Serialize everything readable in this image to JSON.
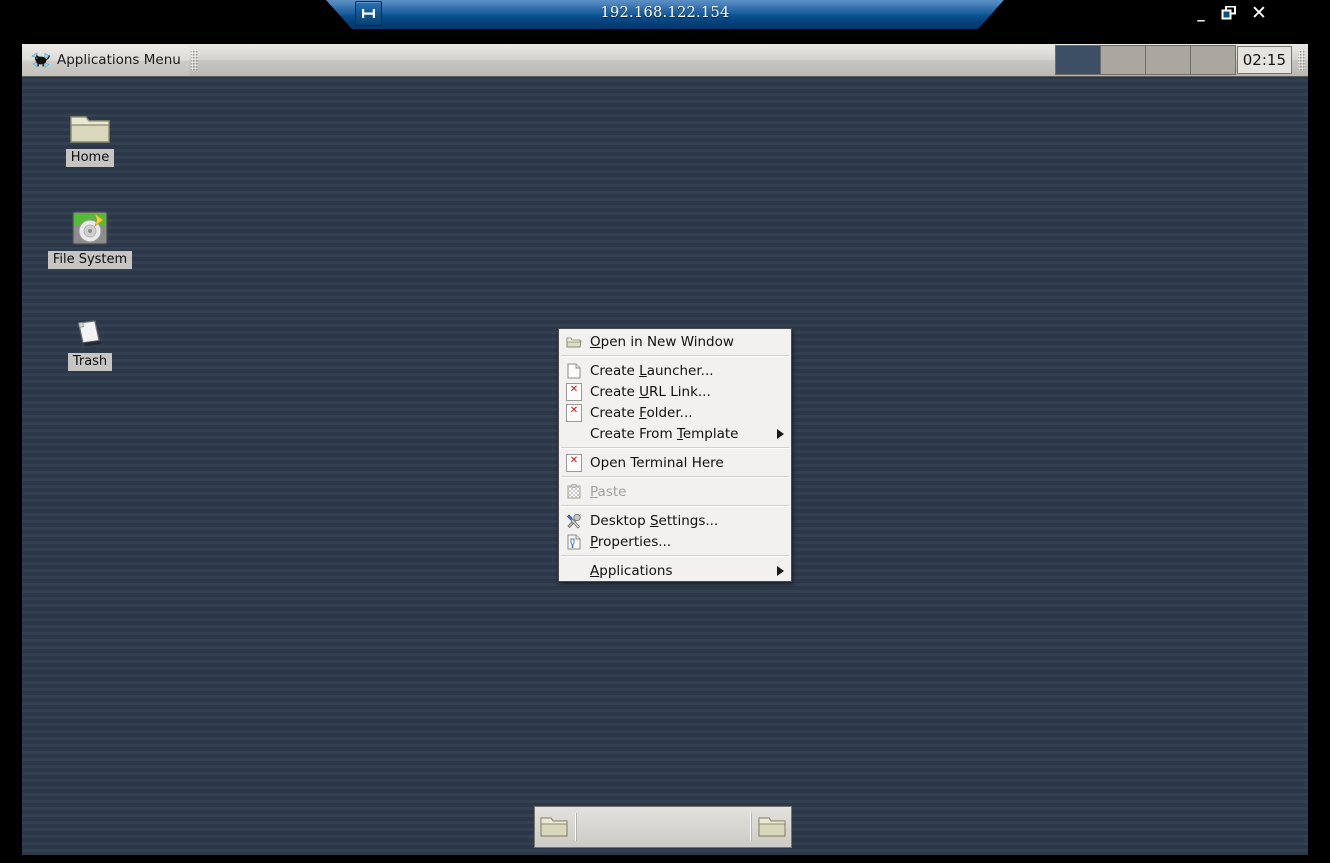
{
  "viewer": {
    "title": "192.168.122.154",
    "pin_icon": "pin-icon",
    "minimize_label": "_",
    "maximize_label": "❐",
    "close_label": "✕"
  },
  "top_panel": {
    "applications_menu_label": "Applications Menu",
    "applications_menu_icon": "xfce-mouse-icon",
    "clock": "02:15",
    "workspaces": [
      {
        "name": "workspace-1",
        "active": true
      },
      {
        "name": "workspace-2",
        "active": false
      },
      {
        "name": "workspace-3",
        "active": false
      },
      {
        "name": "workspace-4",
        "active": false
      }
    ]
  },
  "desktop_icons": [
    {
      "label": "Home",
      "icon": "folder-icon"
    },
    {
      "label": "File System",
      "icon": "harddisk-icon"
    },
    {
      "label": "Trash",
      "icon": "trash-empty-icon"
    }
  ],
  "context_menu": {
    "items": [
      {
        "label": "Open in New Window",
        "accel": "O",
        "icon": "open-folder-icon",
        "disabled": false,
        "submenu": false
      },
      {
        "separator": true
      },
      {
        "label": "Create Launcher...",
        "accel": "L",
        "icon": "document-icon",
        "disabled": false,
        "submenu": false
      },
      {
        "label": "Create URL Link...",
        "accel": "U",
        "icon": "broken-image-icon",
        "disabled": false,
        "submenu": false
      },
      {
        "label": "Create Folder...",
        "accel": "F",
        "icon": "broken-image-icon",
        "disabled": false,
        "submenu": false
      },
      {
        "label": "Create From Template",
        "accel": "T",
        "icon": null,
        "disabled": false,
        "submenu": true
      },
      {
        "separator": true
      },
      {
        "label": "Open Terminal Here",
        "accel": null,
        "icon": "broken-image-icon",
        "disabled": false,
        "submenu": false
      },
      {
        "separator": true
      },
      {
        "label": "Paste",
        "accel": "P",
        "icon": "paste-icon",
        "disabled": true,
        "submenu": false
      },
      {
        "separator": true
      },
      {
        "label": "Desktop Settings...",
        "accel": "S",
        "icon": "tools-icon",
        "disabled": false,
        "submenu": false
      },
      {
        "label": "Properties...",
        "accel": "P",
        "icon": "properties-icon",
        "disabled": false,
        "submenu": false
      },
      {
        "separator": true
      },
      {
        "label": "Applications",
        "accel": "A",
        "icon": null,
        "disabled": false,
        "submenu": true
      }
    ]
  },
  "bottom_panel": {
    "items": [
      {
        "name": "file-manager-launcher",
        "icon": "folder-icon"
      },
      {
        "name": "file-manager-launcher-2",
        "icon": "folder-icon"
      }
    ]
  },
  "colors": {
    "titlebar_blue": "#0d5594",
    "desktop_bg": "#2d3b4c",
    "panel_bg": "#d6d4cf",
    "menu_bg": "#f2f1ef",
    "workspace_active": "#3c4f64"
  }
}
